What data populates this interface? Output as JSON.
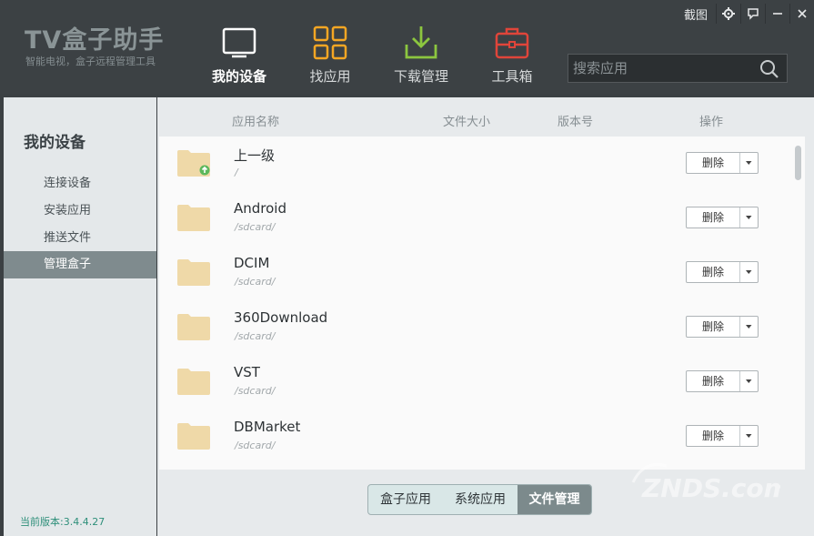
{
  "app": {
    "title": "TV盒子助手",
    "subtitle": "智能电视，盒子远程管理工具"
  },
  "window_controls": {
    "screenshot_label": "截图"
  },
  "nav": [
    {
      "label": "我的设备",
      "icon": "tv-icon",
      "active": true
    },
    {
      "label": "找应用",
      "icon": "apps-grid-icon",
      "active": false
    },
    {
      "label": "下载管理",
      "icon": "download-icon",
      "active": false
    },
    {
      "label": "工具箱",
      "icon": "toolbox-icon",
      "active": false
    }
  ],
  "search": {
    "placeholder": "搜索应用"
  },
  "sidebar": {
    "title": "我的设备",
    "items": [
      {
        "label": "连接设备",
        "active": false
      },
      {
        "label": "安装应用",
        "active": false
      },
      {
        "label": "推送文件",
        "active": false
      },
      {
        "label": "管理盒子",
        "active": true
      }
    ],
    "version": "当前版本:3.4.4.27"
  },
  "table": {
    "columns": [
      "应用名称",
      "文件大小",
      "版本号",
      "操作"
    ],
    "rows": [
      {
        "name": "上一级",
        "path": "/",
        "action": "删除",
        "up_folder": true
      },
      {
        "name": "Android",
        "path": "/sdcard/",
        "action": "删除"
      },
      {
        "name": "DCIM",
        "path": "/sdcard/",
        "action": "删除"
      },
      {
        "name": "360Download",
        "path": "/sdcard/",
        "action": "删除"
      },
      {
        "name": "VST",
        "path": "/sdcard/",
        "action": "删除"
      },
      {
        "name": "DBMarket",
        "path": "/sdcard/",
        "action": "删除"
      }
    ]
  },
  "bottom_tabs": [
    {
      "label": "盒子应用",
      "active": false
    },
    {
      "label": "系统应用",
      "active": false
    },
    {
      "label": "文件管理",
      "active": true
    }
  ],
  "colors": {
    "header_bg": "#3c4144",
    "accent_green": "#8cc63f",
    "accent_orange": "#f5a623",
    "accent_red": "#e0453a",
    "folder": "#efd9a8"
  },
  "watermark": "ZNDS.com"
}
